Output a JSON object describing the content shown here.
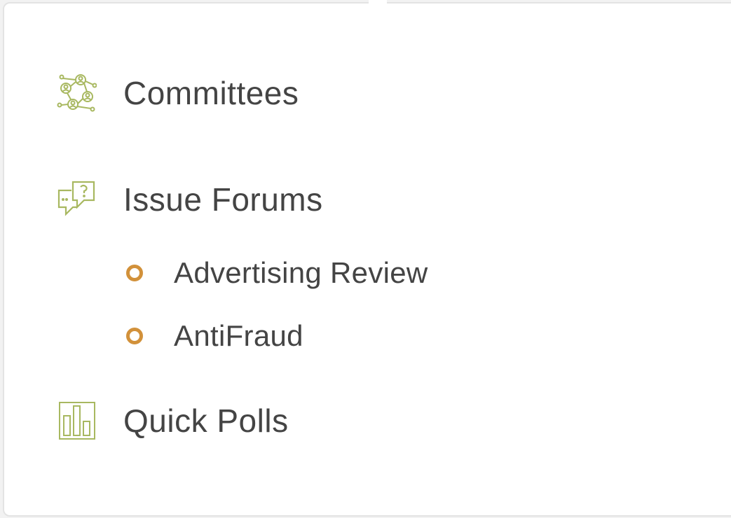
{
  "menu": {
    "items": [
      {
        "label": "Committees",
        "icon": "committees-network-icon"
      },
      {
        "label": "Issue Forums",
        "icon": "forum-chat-question-icon"
      },
      {
        "label": "Quick Polls",
        "icon": "bar-chart-icon"
      }
    ],
    "forums": [
      {
        "label": "Advertising Review"
      },
      {
        "label": "AntiFraud"
      }
    ]
  },
  "colors": {
    "icon": "#a8b860",
    "bullet": "#d2913a",
    "text": "#444444",
    "border": "#e3e3e3"
  }
}
